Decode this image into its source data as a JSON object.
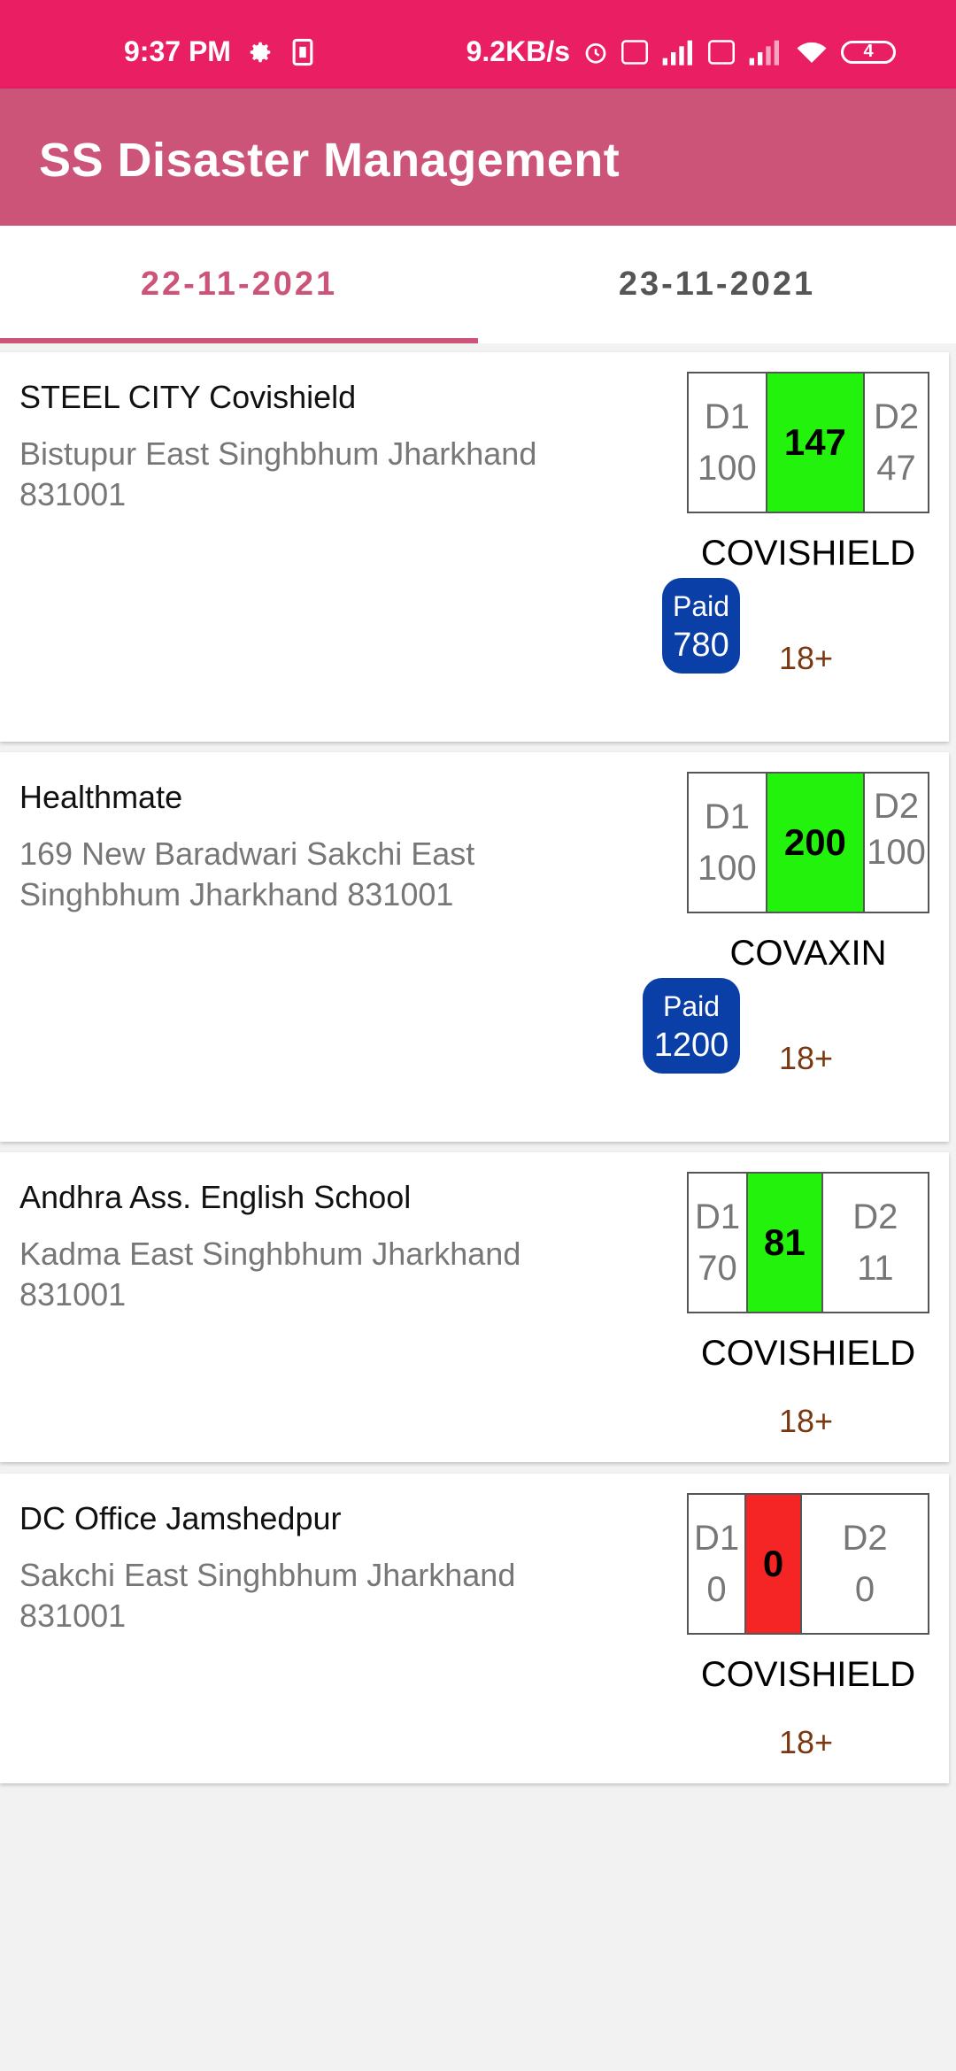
{
  "status_bar": {
    "time": "9:37 PM",
    "network_speed": "9.2KB/s",
    "battery": "4",
    "icons": [
      "gear-icon",
      "sim-icon",
      "alarm-icon",
      "volte-icon",
      "signal-icon",
      "wifi-icon"
    ]
  },
  "app": {
    "title": "SS Disaster Management"
  },
  "tabs": [
    {
      "label": "22-11-2021",
      "active": true
    },
    {
      "label": "23-11-2021",
      "active": false
    }
  ],
  "colors": {
    "status_bar": "#e91e63",
    "app_bar": "#cd5479",
    "available": "#22f20c",
    "unavailable": "#f52525",
    "paid_badge": "#0a3fa8",
    "age_text": "#7a3810"
  },
  "centers": [
    {
      "name": "STEEL CITY Covishield",
      "address": "Bistupur East Singhbhum Jharkhand 831001",
      "d1_label": "D1",
      "d1": "100",
      "total": "147",
      "d2_label": "D2",
      "d2": "47",
      "vaccine": "COVISHIELD",
      "paid_label": "Paid",
      "price": "780",
      "age": "18+"
    },
    {
      "name": "Healthmate",
      "address": "169 New Baradwari Sakchi East Singhbhum Jharkhand 831001",
      "d1_label": "D1",
      "d1": "100",
      "total": "200",
      "d2_label": "D2",
      "d2": "100",
      "vaccine": "COVAXIN",
      "paid_label": "Paid",
      "price": "1200",
      "age": "18+"
    },
    {
      "name": "Andhra Ass. English School",
      "address": "Kadma East Singhbhum Jharkhand 831001",
      "d1_label": "D1",
      "d1": "70",
      "total": "81",
      "d2_label": "D2",
      "d2": "11",
      "vaccine": "COVISHIELD",
      "age": "18+"
    },
    {
      "name": "DC Office Jamshedpur",
      "address": "Sakchi East Singhbhum Jharkhand 831001",
      "d1_label": "D1",
      "d1": "0",
      "total": "0",
      "d2_label": "D2",
      "d2": "0",
      "vaccine": "COVISHIELD",
      "age": "18+"
    }
  ]
}
